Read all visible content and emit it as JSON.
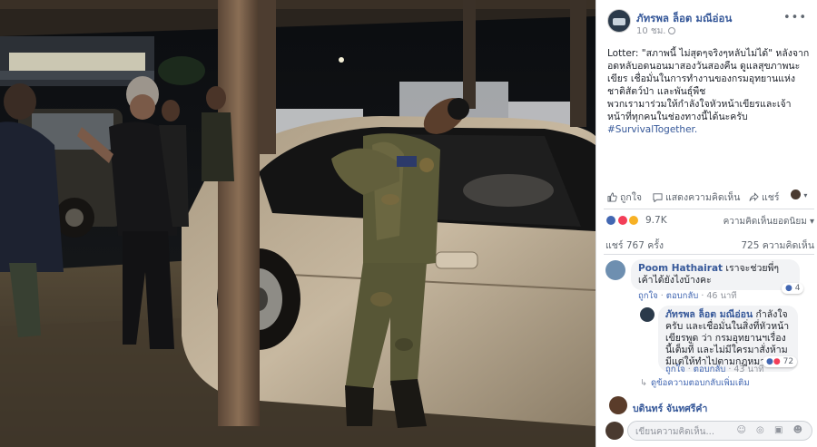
{
  "post": {
    "page_name": "ภัทรพล ล็อต มณีอ่อน",
    "time": "10 ชม.",
    "text_main": "Lotter: \"สภาพนี้ ไม่สุดๆจริงๆหลับไม่ได้\" หลังจากอดหลับอดนอนมาสองวันสองคืน ดูแลสุขภาพนะเขียร เชื่อมั่นในการทำงานของกรมอุทยานแห่งชาติสัตว์ป่า และพันธุ์พืช",
    "text_second": "พวกเรามาร่วมให้กำลังใจหัวหน้าเขียรและเจ้าหน้าที่ทุกคนในช่องทางนี้ได้นะครับ",
    "hashtag": "#SurvivalTogether."
  },
  "actions": {
    "like": "ถูกใจ",
    "comment": "แสดงความคิดเห็น",
    "share": "แชร์"
  },
  "stats": {
    "reactions": "9.7K",
    "sort": "ความคิดเห็นยอดนิยม",
    "shares": "แชร์ 767 ครั้ง",
    "comments": "725 ความคิดเห็น"
  },
  "comments": [
    {
      "author": "Poom Hathairat",
      "text": "เราจะช่วยพี่ๆเค้าได้ยังไงบ้างคะ",
      "like": "ถูกใจ",
      "reply": "ตอบกลับ",
      "time": "46 นาที",
      "reactions": "4"
    },
    {
      "author": "ภัทรพล ล็อต มณีอ่อน",
      "text": "กำลังใจครับ และเชื่อมั่นในสิ่งที่หัวหน้าเขียรพูด ว่า กรมอุทยานฯเรื่องนี้เต็มที่ และไม่มีใครมาสั่งห้าม มีแต่ให้ทำไปตามกฎหมาย",
      "like": "ถูกใจ",
      "reply": "ตอบกลับ",
      "time": "43 นาที",
      "reactions": "72"
    }
  ],
  "more_replies": "ดูข้อความตอบกลับเพิ่มเติม",
  "third_author": "บดินทร์ จันทศรีคำ",
  "write_placeholder": "เขียนความคิดเห็น...",
  "colors": {
    "link": "#365899",
    "like_blue": "#4267b2",
    "love_red": "#f33e58",
    "haha_yellow": "#f7b125"
  }
}
